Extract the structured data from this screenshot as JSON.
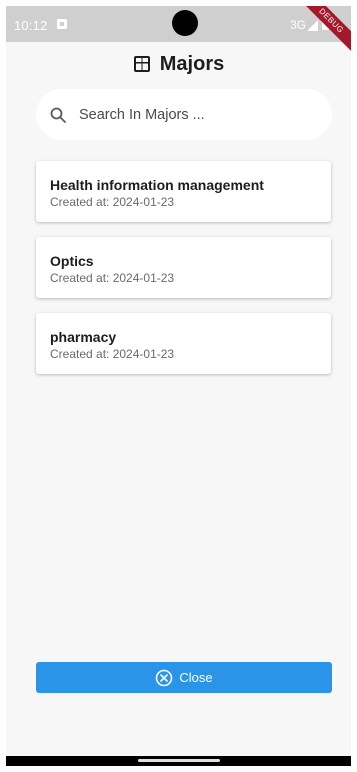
{
  "status_bar": {
    "time": "10:12",
    "network": "3G",
    "debug_label": "DEBUG"
  },
  "header": {
    "title": "Majors",
    "icon": "table-icon"
  },
  "search": {
    "placeholder": "Search In Majors ...",
    "value": ""
  },
  "majors": [
    {
      "name": "Health information management",
      "created": "Created at: 2024-01-23"
    },
    {
      "name": "Optics",
      "created": "Created at: 2024-01-23"
    },
    {
      "name": "pharmacy",
      "created": "Created at: 2024-01-23"
    }
  ],
  "close_button": {
    "label": "Close",
    "icon": "close-circle-icon"
  },
  "colors": {
    "accent": "#2a94e8",
    "background": "#f7f7f7",
    "status_bar": "#cfcfcf",
    "debug_ribbon": "#a3192a"
  }
}
